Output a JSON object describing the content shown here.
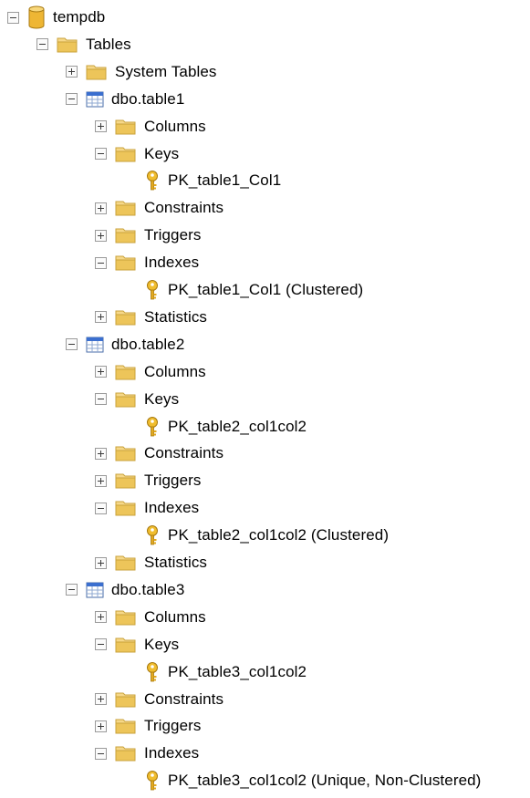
{
  "tree": {
    "nodes": [
      {
        "label": "tempdb",
        "icon": "database-icon",
        "state": "expanded"
      },
      {
        "label": "Tables",
        "icon": "folder-icon",
        "state": "expanded"
      },
      {
        "label": "System Tables",
        "icon": "folder-icon",
        "state": "collapsed"
      },
      {
        "label": "dbo.table1",
        "icon": "table-icon",
        "state": "expanded"
      },
      {
        "label": "Columns",
        "icon": "folder-icon",
        "state": "collapsed"
      },
      {
        "label": "Keys",
        "icon": "folder-icon",
        "state": "expanded"
      },
      {
        "label": "PK_table1_Col1",
        "icon": "key-icon",
        "state": "leaf"
      },
      {
        "label": "Constraints",
        "icon": "folder-icon",
        "state": "collapsed"
      },
      {
        "label": "Triggers",
        "icon": "folder-icon",
        "state": "collapsed"
      },
      {
        "label": "Indexes",
        "icon": "folder-icon",
        "state": "expanded"
      },
      {
        "label": "PK_table1_Col1 (Clustered)",
        "icon": "key-icon",
        "state": "leaf"
      },
      {
        "label": "Statistics",
        "icon": "folder-icon",
        "state": "collapsed"
      },
      {
        "label": "dbo.table2",
        "icon": "table-icon",
        "state": "expanded"
      },
      {
        "label": "Columns",
        "icon": "folder-icon",
        "state": "collapsed"
      },
      {
        "label": "Keys",
        "icon": "folder-icon",
        "state": "expanded"
      },
      {
        "label": "PK_table2_col1col2",
        "icon": "key-icon",
        "state": "leaf"
      },
      {
        "label": "Constraints",
        "icon": "folder-icon",
        "state": "collapsed"
      },
      {
        "label": "Triggers",
        "icon": "folder-icon",
        "state": "collapsed"
      },
      {
        "label": "Indexes",
        "icon": "folder-icon",
        "state": "expanded"
      },
      {
        "label": "PK_table2_col1col2 (Clustered)",
        "icon": "key-icon",
        "state": "leaf"
      },
      {
        "label": "Statistics",
        "icon": "folder-icon",
        "state": "collapsed"
      },
      {
        "label": "dbo.table3",
        "icon": "table-icon",
        "state": "expanded"
      },
      {
        "label": "Columns",
        "icon": "folder-icon",
        "state": "collapsed"
      },
      {
        "label": "Keys",
        "icon": "folder-icon",
        "state": "expanded"
      },
      {
        "label": "PK_table3_col1col2",
        "icon": "key-icon",
        "state": "leaf"
      },
      {
        "label": "Constraints",
        "icon": "folder-icon",
        "state": "collapsed"
      },
      {
        "label": "Triggers",
        "icon": "folder-icon",
        "state": "collapsed"
      },
      {
        "label": "Indexes",
        "icon": "folder-icon",
        "state": "expanded"
      },
      {
        "label": "PK_table3_col1col2 (Unique, Non-Clustered)",
        "icon": "key-icon",
        "state": "leaf"
      }
    ]
  },
  "colors": {
    "folder": "#e8c25a",
    "database": "#e6b12f",
    "table_header": "#3b6fcf",
    "key": "#d9a520"
  }
}
